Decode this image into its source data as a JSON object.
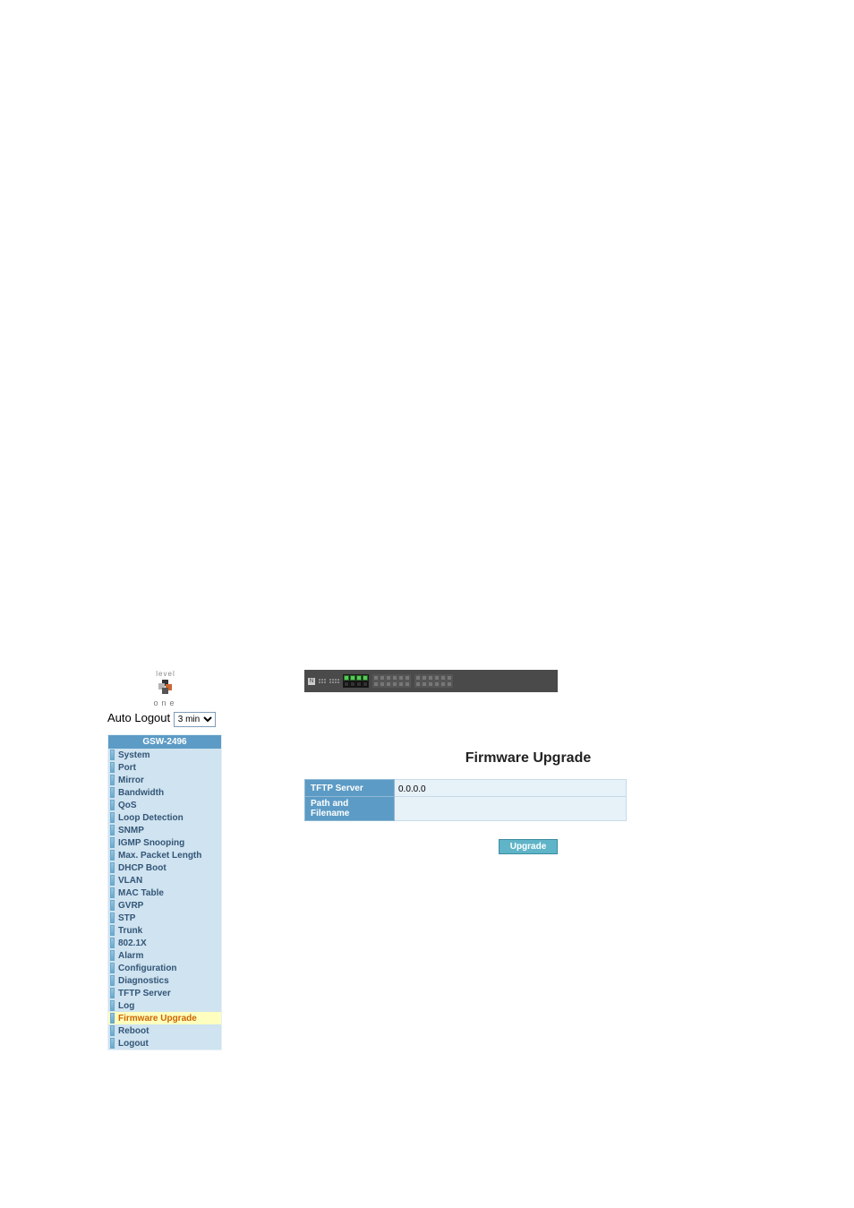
{
  "logo": {
    "top": "level",
    "bottom": "one"
  },
  "autologout": {
    "label": "Auto Logout",
    "selected": "3 min",
    "options": [
      "3 min"
    ]
  },
  "menu": {
    "header": "GSW-2496",
    "items": [
      {
        "label": "System",
        "selected": false
      },
      {
        "label": "Port",
        "selected": false
      },
      {
        "label": "Mirror",
        "selected": false
      },
      {
        "label": "Bandwidth",
        "selected": false
      },
      {
        "label": "QoS",
        "selected": false
      },
      {
        "label": "Loop Detection",
        "selected": false
      },
      {
        "label": "SNMP",
        "selected": false
      },
      {
        "label": "IGMP Snooping",
        "selected": false
      },
      {
        "label": "Max. Packet Length",
        "selected": false
      },
      {
        "label": "DHCP Boot",
        "selected": false
      },
      {
        "label": "VLAN",
        "selected": false
      },
      {
        "label": "MAC Table",
        "selected": false
      },
      {
        "label": "GVRP",
        "selected": false
      },
      {
        "label": "STP",
        "selected": false
      },
      {
        "label": "Trunk",
        "selected": false
      },
      {
        "label": "802.1X",
        "selected": false
      },
      {
        "label": "Alarm",
        "selected": false
      },
      {
        "label": "Configuration",
        "selected": false
      },
      {
        "label": "Diagnostics",
        "selected": false
      },
      {
        "label": "TFTP Server",
        "selected": false
      },
      {
        "label": "Log",
        "selected": false
      },
      {
        "label": "Firmware Upgrade",
        "selected": true
      },
      {
        "label": "Reboot",
        "selected": false
      },
      {
        "label": "Logout",
        "selected": false
      }
    ]
  },
  "content": {
    "title": "Firmware Upgrade",
    "fields": {
      "tftp_server": {
        "label": "TFTP Server",
        "value": "0.0.0.0"
      },
      "path_filename": {
        "label": "Path and Filename",
        "value": ""
      }
    },
    "button": "Upgrade"
  }
}
